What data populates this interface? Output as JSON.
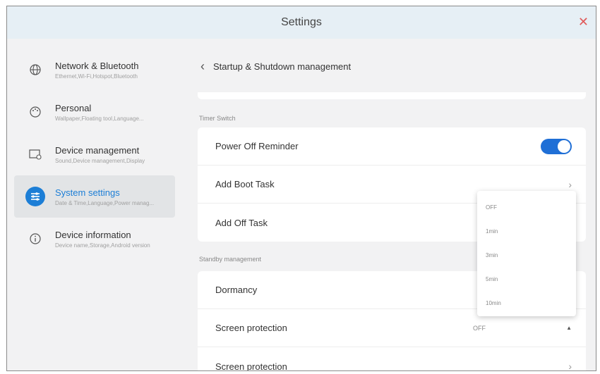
{
  "window": {
    "title": "Settings",
    "close_icon": "✕"
  },
  "sidebar": {
    "items": [
      {
        "label": "Network & Bluetooth",
        "sub": "Ethernet,Wi-Fi,Hotspot,Bluetooth"
      },
      {
        "label": "Personal",
        "sub": "Wallpaper,Floating tool,Language..."
      },
      {
        "label": "Device management",
        "sub": "Sound,Device management,Display"
      },
      {
        "label": "System settings",
        "sub": "Date & Time,Language,Power manag..."
      },
      {
        "label": "Device information",
        "sub": "Device name,Storage,Android version"
      }
    ]
  },
  "main": {
    "header_title": "Startup & Shutdown management",
    "timer_section": {
      "label": "Timer Switch",
      "rows": [
        {
          "label": "Power Off Reminder"
        },
        {
          "label": "Add Boot Task"
        },
        {
          "label": "Add Off Task"
        }
      ]
    },
    "standby_section": {
      "label": "Standby management",
      "rows": [
        {
          "label": "Dormancy"
        },
        {
          "label": "Screen protection",
          "value": "OFF"
        },
        {
          "label": "Screen protection"
        }
      ]
    },
    "dropdown": {
      "options": [
        "OFF",
        "1min",
        "3min",
        "5min",
        "10min"
      ]
    }
  },
  "colors": {
    "accent": "#1f6fd6",
    "close": "#e05a5a",
    "titlebar": "#e6eff5"
  }
}
